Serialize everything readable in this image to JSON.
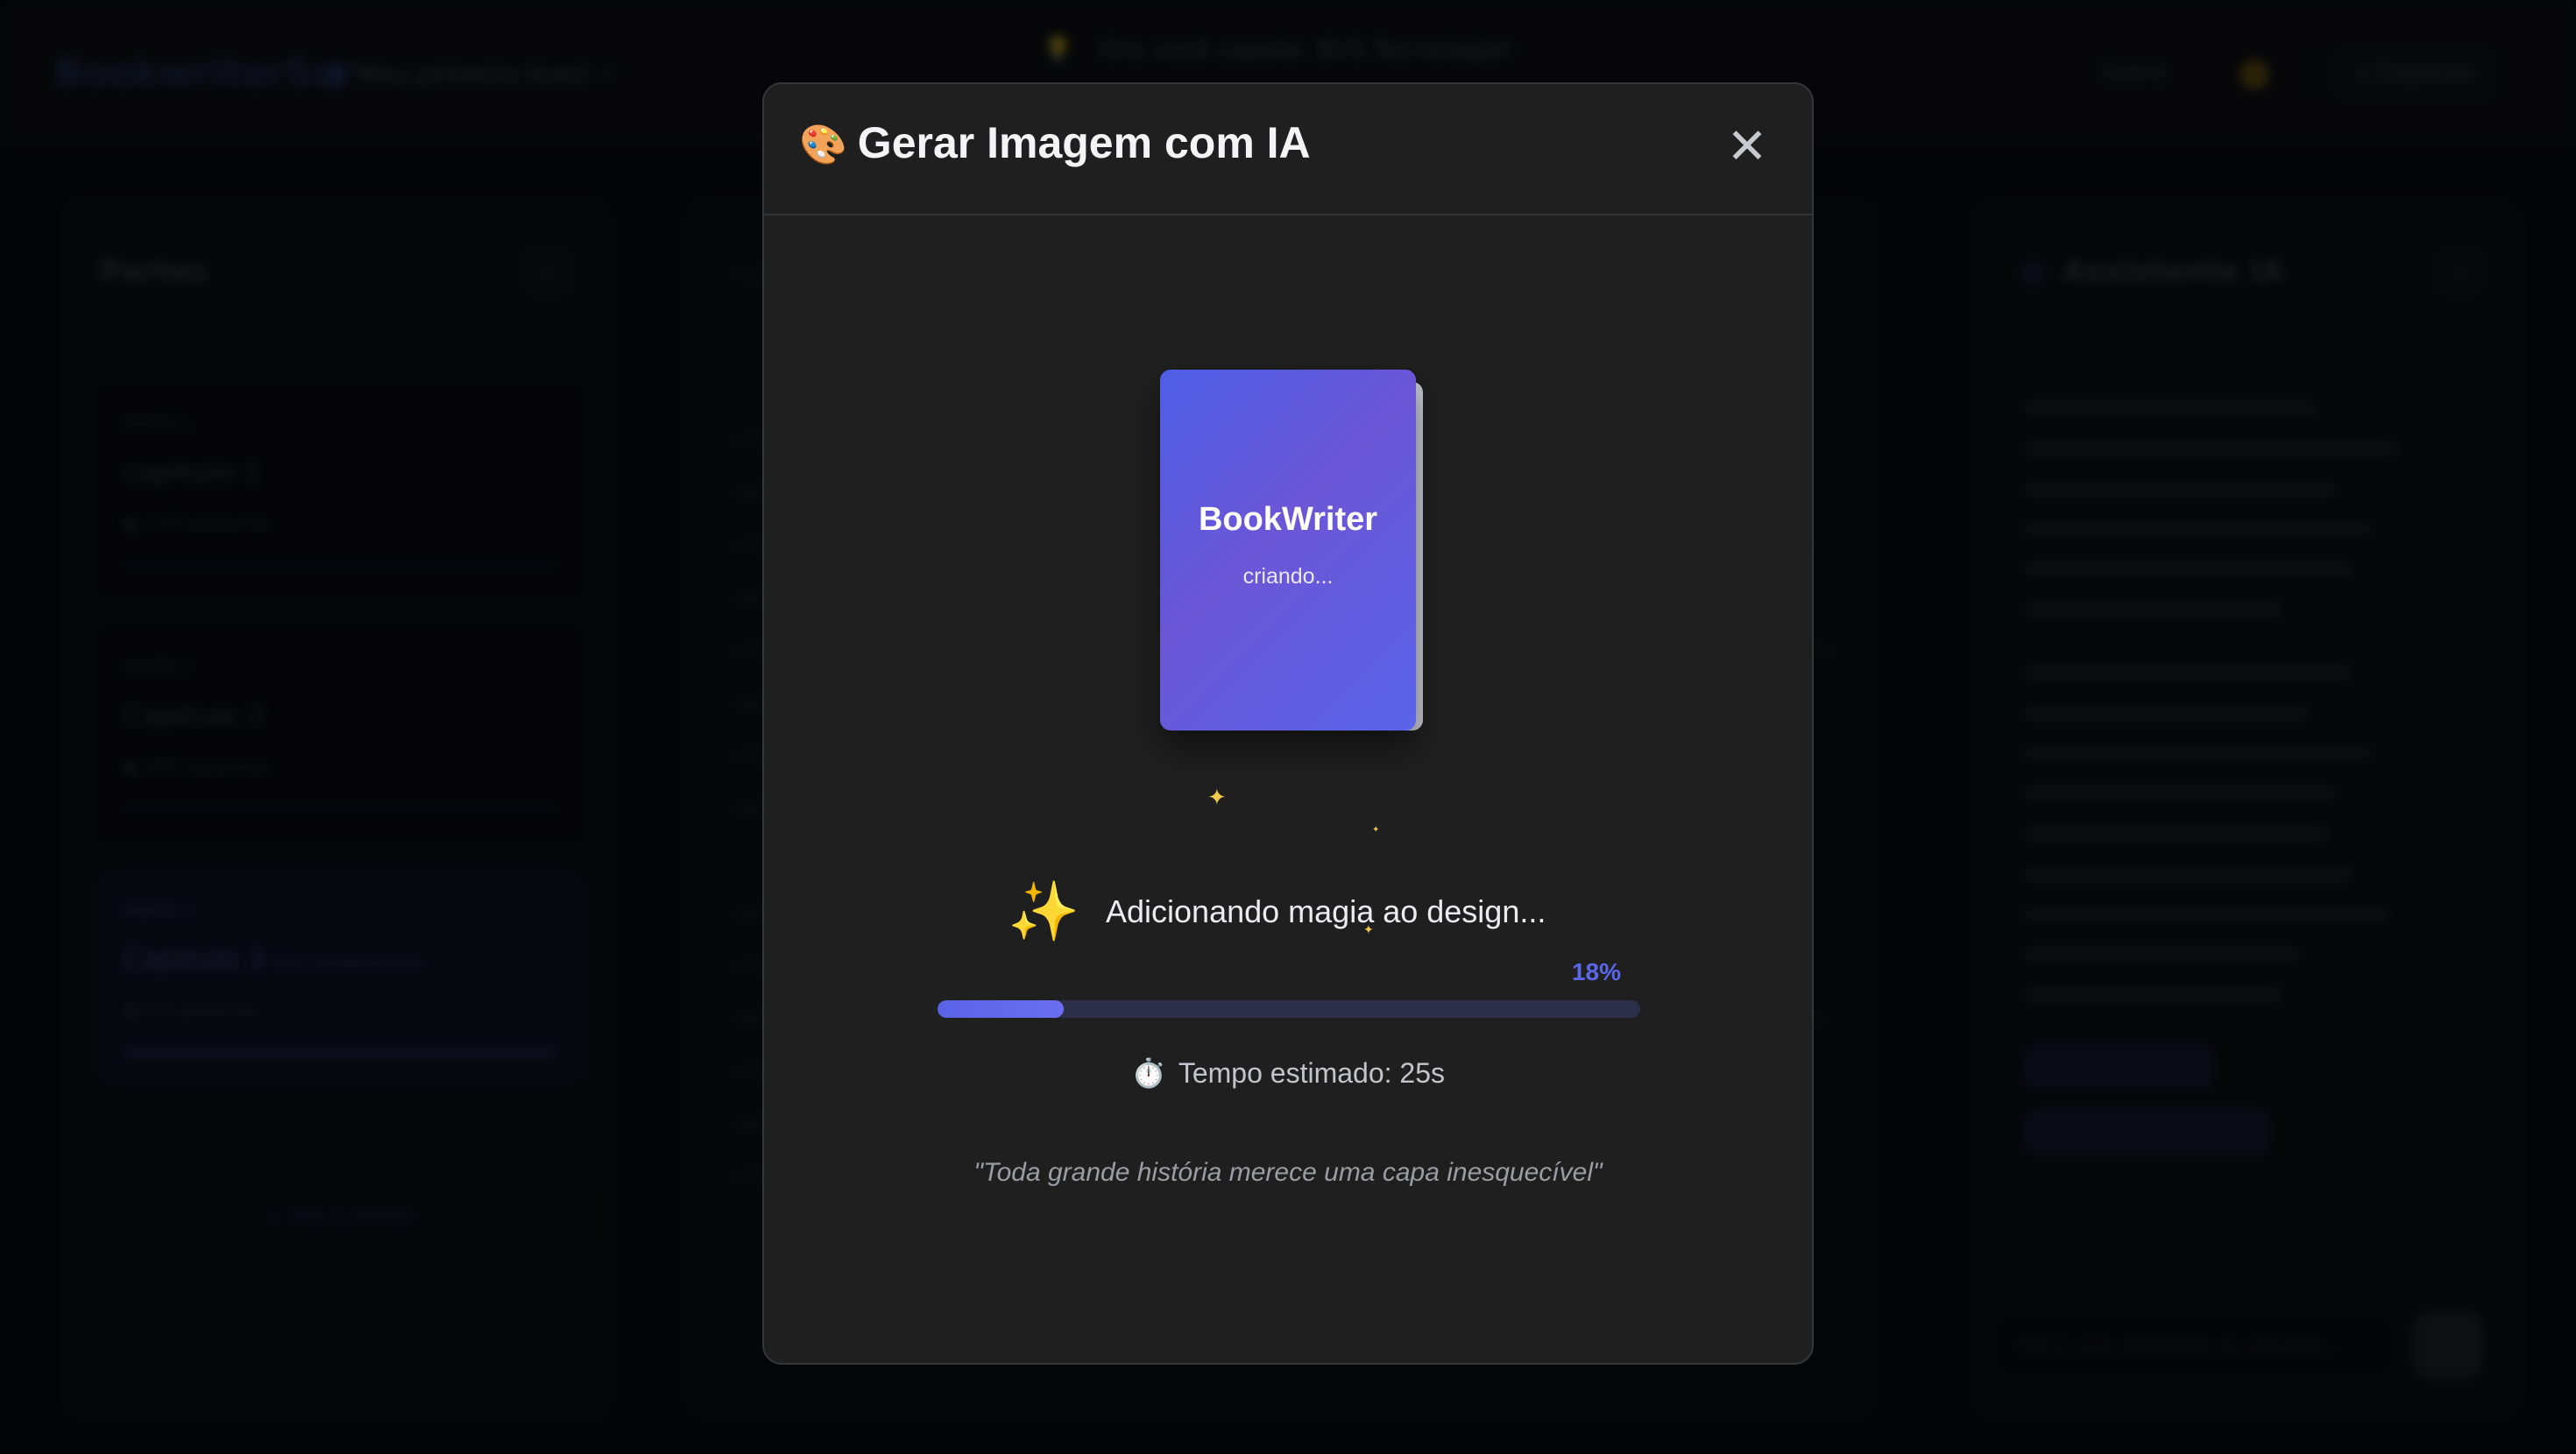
{
  "background": {
    "app_logo": "BookwriterSer",
    "project_name": "Meu primeiro livro! ✓",
    "banner_text": "Ora você capote. BVS Tecnologia!",
    "nav_link": "Sobre",
    "export_label": "⇩ Exportar",
    "left_panel": {
      "title": "Partes",
      "chapters": [
        {
          "part": "PARTE 1",
          "name": "capitulo 1",
          "sub": "",
          "words": "◉ 170 palavras"
        },
        {
          "part": "PARTE 2",
          "name": "Capitulo 2",
          "sub": "",
          "words": "◉ 187 palavras"
        },
        {
          "part": "PARTE 3",
          "name": "Capitulo 3",
          "sub": "Em andamento",
          "words": "◉ 97 palavras"
        }
      ],
      "new_part_label": "+ Nova Parte"
    },
    "right_panel": {
      "title": "Assistente IA",
      "input_placeholder": "Peça sua resposta ou dúvida..."
    }
  },
  "modal": {
    "palette_icon": "🎨",
    "title": "Gerar Imagem com IA",
    "close_icon": "✕",
    "book": {
      "title": "BookWriter",
      "subtitle": "criando..."
    },
    "status_icon": "✨",
    "status_text": "Adicionando magia ao design...",
    "progress_percent_label": "18%",
    "progress_value": 0.18,
    "timer_icon": "⏱️",
    "estimate_text": "Tempo estimado: 25s",
    "quote": "\"Toda grande história merece uma capa inesquecível\""
  },
  "colors": {
    "accent": "#5a67e8",
    "modal_bg": "#1f1f20",
    "book_gradient_start": "#4d5ee6",
    "book_gradient_end": "#6b56d6"
  }
}
